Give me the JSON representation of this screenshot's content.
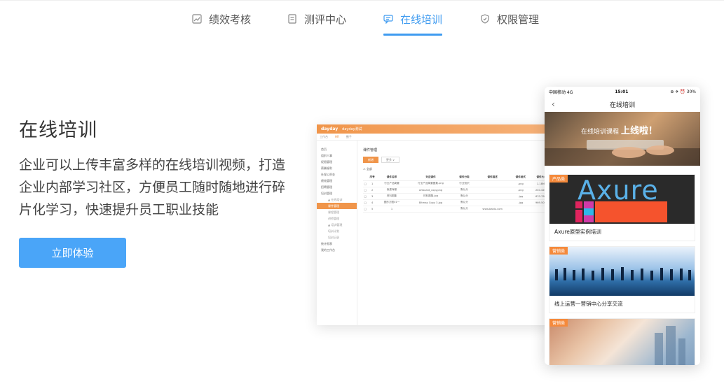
{
  "nav": {
    "tabs": [
      {
        "label": "绩效考核",
        "icon": "chart-icon"
      },
      {
        "label": "测评中心",
        "icon": "document-icon"
      },
      {
        "label": "在线培训",
        "icon": "chat-icon",
        "active": true
      },
      {
        "label": "权限管理",
        "icon": "shield-icon"
      }
    ],
    "accent": "#3f9bf0"
  },
  "hero": {
    "title": "在线培训",
    "description": "企业可以上传丰富多样的在线培训视频，打造企业内部学习社区，方便员工随时随地进行碎片化学习，快速提升员工职业技能",
    "cta_label": "立即体验",
    "cta_color": "#4aa5f8"
  },
  "desktop_mock": {
    "logo": "dayday",
    "app_name": "dayday测试",
    "tabs": [
      "工作台",
      "HR",
      "圈子"
    ],
    "sidebar": [
      {
        "label": "首页"
      },
      {
        "label": "组织人事"
      },
      {
        "label": "权限管理"
      },
      {
        "label": "薪酬福利"
      },
      {
        "label": "社保公积金"
      },
      {
        "label": "绩效管理"
      },
      {
        "label": "招聘管理"
      },
      {
        "label": "培训管理"
      },
      {
        "label": "▲ 在线培训",
        "sub": true
      },
      {
        "label": "课件管理",
        "sub": true,
        "active": true
      },
      {
        "label": "课程管理",
        "sub": true
      },
      {
        "label": "讲师管理",
        "sub": true
      },
      {
        "label": "▲ 培训管理",
        "sub": true
      },
      {
        "label": "培训计划",
        "sub": true
      },
      {
        "label": "培训记录",
        "sub": true
      },
      {
        "label": "统计报表"
      },
      {
        "label": "我的工作台"
      }
    ],
    "page_title": "课件管理",
    "add_label": "新增",
    "more_label": "更多 ∨",
    "all_label": "全部",
    "columns": [
      "序号",
      "课件名称",
      "对应课件",
      "课件分类",
      "课件描述",
      "课件格式",
      "课件大小"
    ],
    "rows": [
      [
        "1",
        "行业产品简要",
        "行业产品简要图集.png",
        "行业知识",
        "",
        ".png",
        "1.18MB"
      ],
      [
        "2",
        "我是海报",
        "artboard_copy.png",
        "默认分",
        "",
        ".png",
        "240.42KB"
      ],
      [
        "3",
        "材料图集",
        "材料图集.jpg",
        "默认分",
        "",
        ".jpg",
        "670.79KB"
      ],
      [
        "4",
        "图形方图01一",
        "Bitmap Copy 3.jpg",
        "默认分",
        "",
        ".jpg",
        "969.50KB"
      ],
      [
        "5",
        "1",
        "",
        "默认分",
        "www.baidu.com",
        "",
        ""
      ]
    ]
  },
  "phone_mock": {
    "carrier": "中国移动  4G",
    "time": "15:01",
    "battery": "⊕ ✈ ⏰ 30%",
    "title": "在线培训",
    "banner_text": "在线培训课程",
    "banner_highlight": "上线啦！",
    "cards": [
      {
        "tag": "产品类",
        "art": "Axure",
        "caption": "Axure原型实例培训"
      },
      {
        "tag": "营销类",
        "caption": "线上运营一营销中心分享交流"
      },
      {
        "tag": "营销类",
        "caption": ""
      }
    ],
    "tag_color": "#f58a3c"
  }
}
